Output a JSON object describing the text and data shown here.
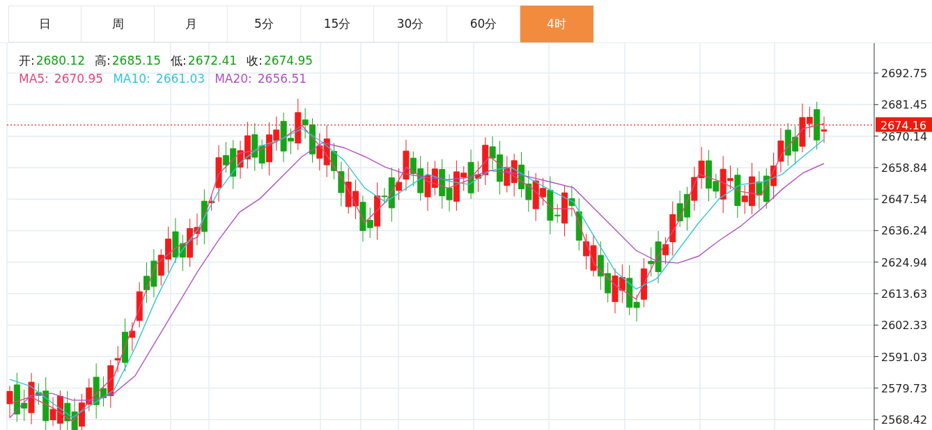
{
  "tabs": [
    {
      "label": "日",
      "selected": false
    },
    {
      "label": "周",
      "selected": false
    },
    {
      "label": "月",
      "selected": false
    },
    {
      "label": "5分",
      "selected": false
    },
    {
      "label": "15分",
      "selected": false
    },
    {
      "label": "30分",
      "selected": false
    },
    {
      "label": "60分",
      "selected": false
    },
    {
      "label": "4时",
      "selected": true
    }
  ],
  "chart": {
    "ohlc": [
      {
        "label": "开:",
        "value": "2680.12"
      },
      {
        "label": "高:",
        "value": "2685.15"
      },
      {
        "label": "低:",
        "value": "2672.41"
      },
      {
        "label": "收:",
        "value": "2674.95"
      }
    ],
    "ma_legend": [
      {
        "separator": ":",
        "value": "2670.95"
      },
      {
        "separator": ":",
        "value": "2661.03"
      },
      {
        "separator": ":",
        "value": "2656.51"
      }
    ],
    "chart_data": {
      "type": "line",
      "grid": true,
      "ylim": [
        2564.7,
        2703.5
      ],
      "yticks": [
        {
          "value": 2692.75,
          "label": "2692.75"
        },
        {
          "value": 2681.45,
          "label": "2681.45"
        },
        {
          "value": 2670.14,
          "label": "2670.14"
        },
        {
          "value": 2658.84,
          "label": "2658.84"
        },
        {
          "value": 2647.54,
          "label": "2647.54"
        },
        {
          "value": 2636.24,
          "label": "2636.24"
        },
        {
          "value": 2624.94,
          "label": "2624.94"
        },
        {
          "value": 2613.63,
          "label": "2613.63"
        },
        {
          "value": 2602.33,
          "label": "2602.33"
        },
        {
          "value": 2591.03,
          "label": "2591.03"
        },
        {
          "value": 2579.73,
          "label": "2579.73"
        },
        {
          "value": 2568.42,
          "label": "2568.42"
        }
      ],
      "series": [
        {
          "name": "MA5",
          "color": "#e8457a",
          "values": [
            2574.1,
            2576.6,
            2572.9,
            2567.9,
            2576.6,
            2584.1,
            2604.1,
            2624.1,
            2630.3,
            2634.0,
            2656.5,
            2664.0,
            2665.3,
            2669.0,
            2674.0,
            2665.3,
            2654.0,
            2639.1,
            2646.5,
            2659.0,
            2654.0,
            2651.5,
            2654.5,
            2662.8,
            2656.5,
            2651.5,
            2644.1,
            2644.1,
            2624.1,
            2616.6,
            2611.6,
            2626.6,
            2639.1,
            2656.5,
            2654.0,
            2650.3,
            2649.0,
            2664.0,
            2672.8,
            2674.6
          ]
        },
        {
          "name": "MA10",
          "color": "#2ec7d9",
          "values": [
            2582.9,
            2580.4,
            2574.6,
            2569.2,
            2574.1,
            2579.1,
            2594.1,
            2611.6,
            2626.6,
            2636.6,
            2650.3,
            2660.3,
            2666.5,
            2669.0,
            2672.8,
            2667.8,
            2661.5,
            2651.5,
            2646.5,
            2651.5,
            2656.5,
            2654.0,
            2652.8,
            2657.8,
            2659.0,
            2654.5,
            2650.3,
            2646.5,
            2634.0,
            2621.6,
            2615.3,
            2619.1,
            2629.1,
            2639.1,
            2647.8,
            2652.8,
            2653.5,
            2656.5,
            2662.8,
            2669.0
          ]
        },
        {
          "name": "MA20",
          "color": "#b44fc6",
          "values": [
            2569.1,
            2577.1,
            2577.9,
            2575.4,
            2575.4,
            2577.9,
            2584.1,
            2596.6,
            2609.1,
            2621.6,
            2632.8,
            2642.8,
            2647.8,
            2655.3,
            2662.8,
            2667.8,
            2666.0,
            2662.8,
            2659.0,
            2656.5,
            2655.3,
            2654.5,
            2655.3,
            2657.8,
            2657.0,
            2655.3,
            2653.5,
            2651.6,
            2644.1,
            2636.6,
            2629.1,
            2625.3,
            2624.6,
            2627.1,
            2632.8,
            2637.8,
            2644.1,
            2651.1,
            2657.0,
            2660.3
          ]
        }
      ],
      "ref_lines": [
        {
          "axis": "y",
          "value": 2674.16,
          "label": "2674.16"
        }
      ]
    }
  }
}
